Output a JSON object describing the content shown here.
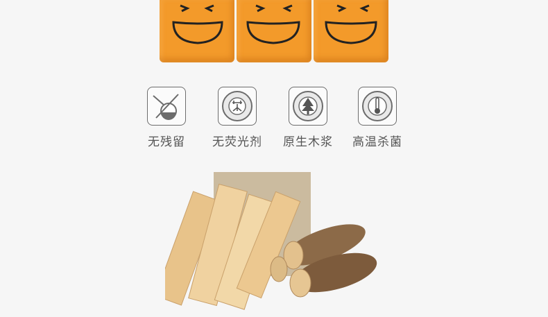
{
  "features": [
    {
      "label": "无残留",
      "icon": "no-residue-icon"
    },
    {
      "label": "无荧光剂",
      "icon": "no-fluorescent-agent-icon"
    },
    {
      "label": "原生木浆",
      "icon": "virgin-wood-pulp-icon"
    },
    {
      "label": "高温杀菌",
      "icon": "high-temperature-sterilization-icon"
    }
  ],
  "colors": {
    "pack_orange": "#f39a2a",
    "icon_gray": "#6c6c6c",
    "label_gray": "#555555"
  }
}
